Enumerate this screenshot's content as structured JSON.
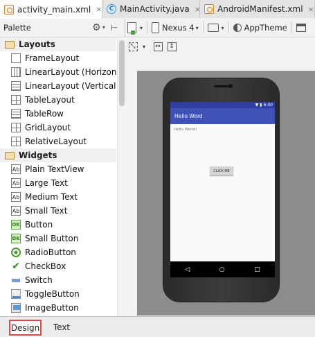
{
  "editor_tabs": [
    {
      "label": "activity_main.xml",
      "icon": "xml-layout-icon",
      "active": true
    },
    {
      "label": "MainActivity.java",
      "icon": "java-class-icon",
      "active": false
    },
    {
      "label": "AndroidManifest.xml",
      "icon": "xml-manifest-icon",
      "active": false
    }
  ],
  "close_glyph": "×",
  "palette": {
    "title": "Palette",
    "categories": [
      {
        "label": "Layouts",
        "items": [
          {
            "label": "FrameLayout",
            "icon": "frame-layout-icon"
          },
          {
            "label": "LinearLayout (Horizontal)",
            "icon": "linear-horizontal-icon"
          },
          {
            "label": "LinearLayout (Vertical)",
            "icon": "linear-vertical-icon"
          },
          {
            "label": "TableLayout",
            "icon": "table-layout-icon"
          },
          {
            "label": "TableRow",
            "icon": "table-row-icon"
          },
          {
            "label": "GridLayout",
            "icon": "grid-layout-icon"
          },
          {
            "label": "RelativeLayout",
            "icon": "relative-layout-icon"
          }
        ]
      },
      {
        "label": "Widgets",
        "items": [
          {
            "label": "Plain TextView",
            "icon": "textview-icon",
            "glyph": "Ab"
          },
          {
            "label": "Large Text",
            "icon": "large-text-icon",
            "glyph": "Ab"
          },
          {
            "label": "Medium Text",
            "icon": "medium-text-icon",
            "glyph": "Ab"
          },
          {
            "label": "Small Text",
            "icon": "small-text-icon",
            "glyph": "Ab"
          },
          {
            "label": "Button",
            "icon": "button-icon",
            "glyph": "OK"
          },
          {
            "label": "Small Button",
            "icon": "small-button-icon",
            "glyph": "OK"
          },
          {
            "label": "RadioButton",
            "icon": "radio-button-icon"
          },
          {
            "label": "CheckBox",
            "icon": "checkbox-icon",
            "glyph": "✔"
          },
          {
            "label": "Switch",
            "icon": "switch-icon"
          },
          {
            "label": "ToggleButton",
            "icon": "toggle-button-icon"
          },
          {
            "label": "ImageButton",
            "icon": "image-button-icon"
          }
        ]
      }
    ]
  },
  "toolbar": {
    "device": "Nexus 4",
    "theme": "AppTheme",
    "dropdown_glyph": "▾"
  },
  "preview": {
    "status_time": "6:00",
    "app_title": "Hello Word",
    "text_view": "Hello World!",
    "button_label": "CLICK ME",
    "nav_back": "◁",
    "nav_home": "○",
    "nav_recent": "□"
  },
  "bottom_tabs": [
    {
      "label": "Design",
      "active": true
    },
    {
      "label": "Text",
      "active": false
    }
  ],
  "colors": {
    "status_bar": "#303f9f",
    "action_bar": "#3f51b5",
    "design_tab_highlight": "#e04c4c"
  }
}
